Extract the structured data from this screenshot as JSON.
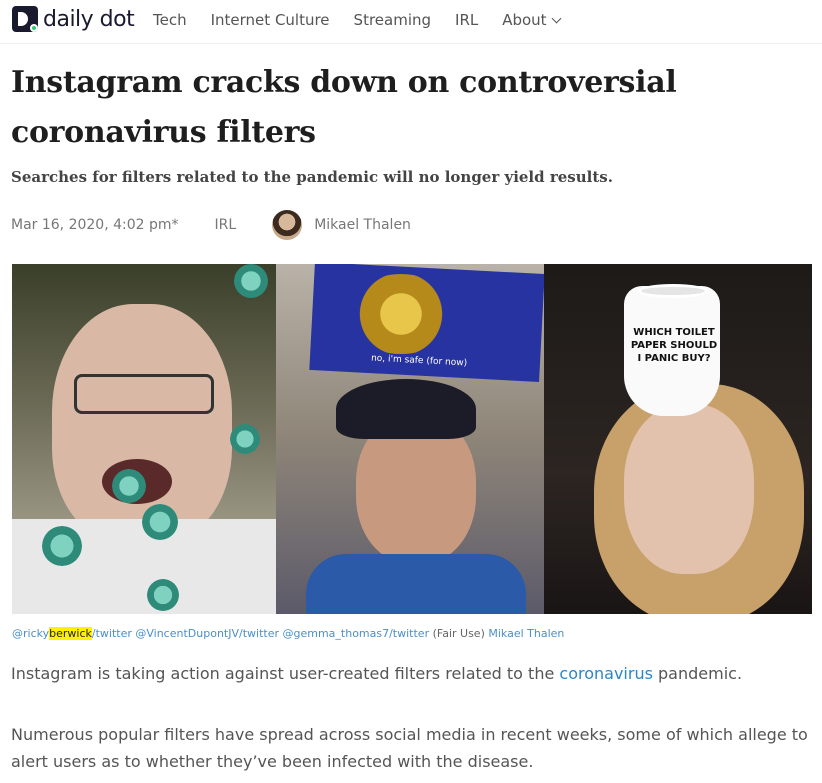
{
  "nav": {
    "logo_text": "daily dot",
    "items": [
      "Tech",
      "Internet Culture",
      "Streaming",
      "IRL",
      "About"
    ]
  },
  "article": {
    "headline": "Instagram cracks down on controversial coronavirus filters",
    "dek": "Searches for filters related to the pandemic will no longer yield results.",
    "date": "Mar 16, 2020, 4:02 pm*",
    "category": "IRL",
    "author": "Mikael Thalen"
  },
  "image": {
    "overlay_caption": "no, i'm safe (for now)",
    "roll_text": "WHICH TOILET PAPER SHOULD I PANIC BUY?",
    "credit_1a": "@ricky",
    "credit_1b": "berwick",
    "credit_1c": "/twitter",
    "credit_2": "@VincentDupontJV/twitter",
    "credit_3": "@gemma_thomas7/twitter",
    "credit_fair": "(Fair Use)",
    "credit_author": "Mikael Thalen"
  },
  "body": {
    "p1_before": "Instagram is taking action against user-created filters related to the ",
    "p1_link": "coronavirus",
    "p1_after": " pandemic.",
    "p2": "Numerous popular filters have spread across social media in recent weeks, some of which allege to alert users as to whether they’ve been infected with the disease."
  }
}
